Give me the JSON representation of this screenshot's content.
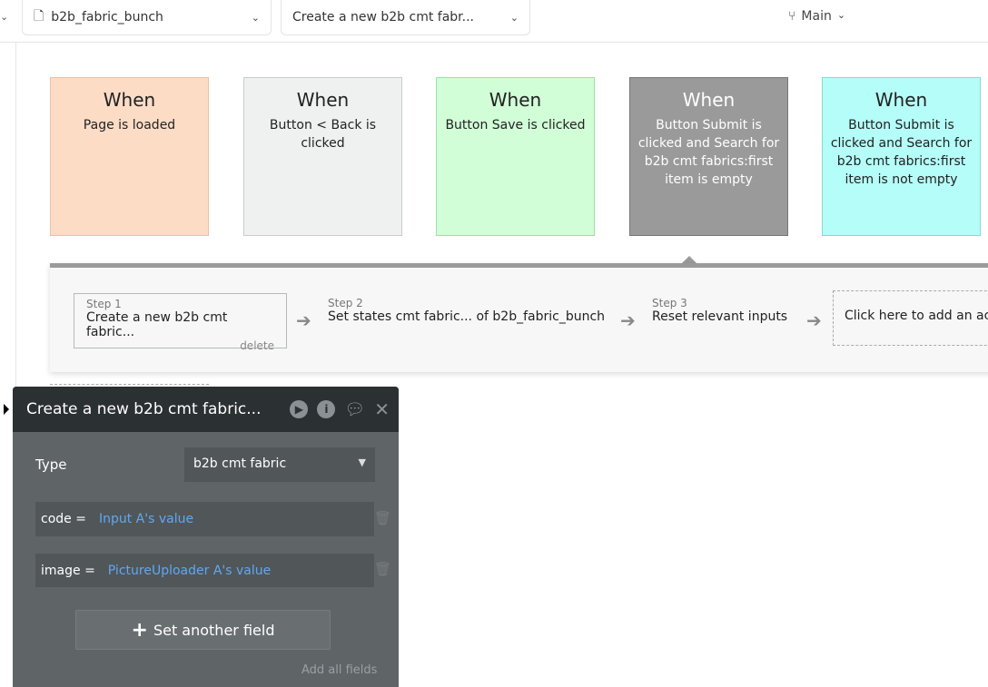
{
  "topbar": {
    "page_dropdown": "b2b_fabric_bunch",
    "workflow_dropdown": "Create a new b2b cmt fabr...",
    "branch": "Main"
  },
  "events": [
    {
      "title": "When",
      "condition": "Page is loaded",
      "color": "#fddcc6"
    },
    {
      "title": "When",
      "condition": "Button < Back is clicked",
      "color": "#eff1f1"
    },
    {
      "title": "When",
      "condition": "Button Save is clicked",
      "color": "#d1fdd7"
    },
    {
      "title": "When",
      "condition": "Button Submit is clicked and Search for b2b cmt fabrics:first item is empty",
      "color": "#9a9a9a"
    },
    {
      "title": "When",
      "condition": "Button Submit is clicked and Search for b2b cmt fabrics:first item is not empty",
      "color": "#b5fdf8"
    }
  ],
  "steps": [
    {
      "label": "Step 1",
      "action": "Create a new b2b cmt fabric...",
      "delete": "delete"
    },
    {
      "label": "Step 2",
      "action": "Set states cmt fabric... of b2b_fabric_bunch"
    },
    {
      "label": "Step 3",
      "action": "Reset relevant inputs"
    }
  ],
  "add_action": "Click here to add an action...",
  "editor": {
    "title": "Create a new b2b cmt fabric...",
    "type_label": "Type",
    "type_value": "b2b cmt fabric",
    "fields": [
      {
        "name": "code",
        "op": "=",
        "value": "Input A's value"
      },
      {
        "name": "image",
        "op": "=",
        "value": "PictureUploader A's value"
      }
    ],
    "set_another": "Set another field",
    "add_all": "Add all fields"
  }
}
